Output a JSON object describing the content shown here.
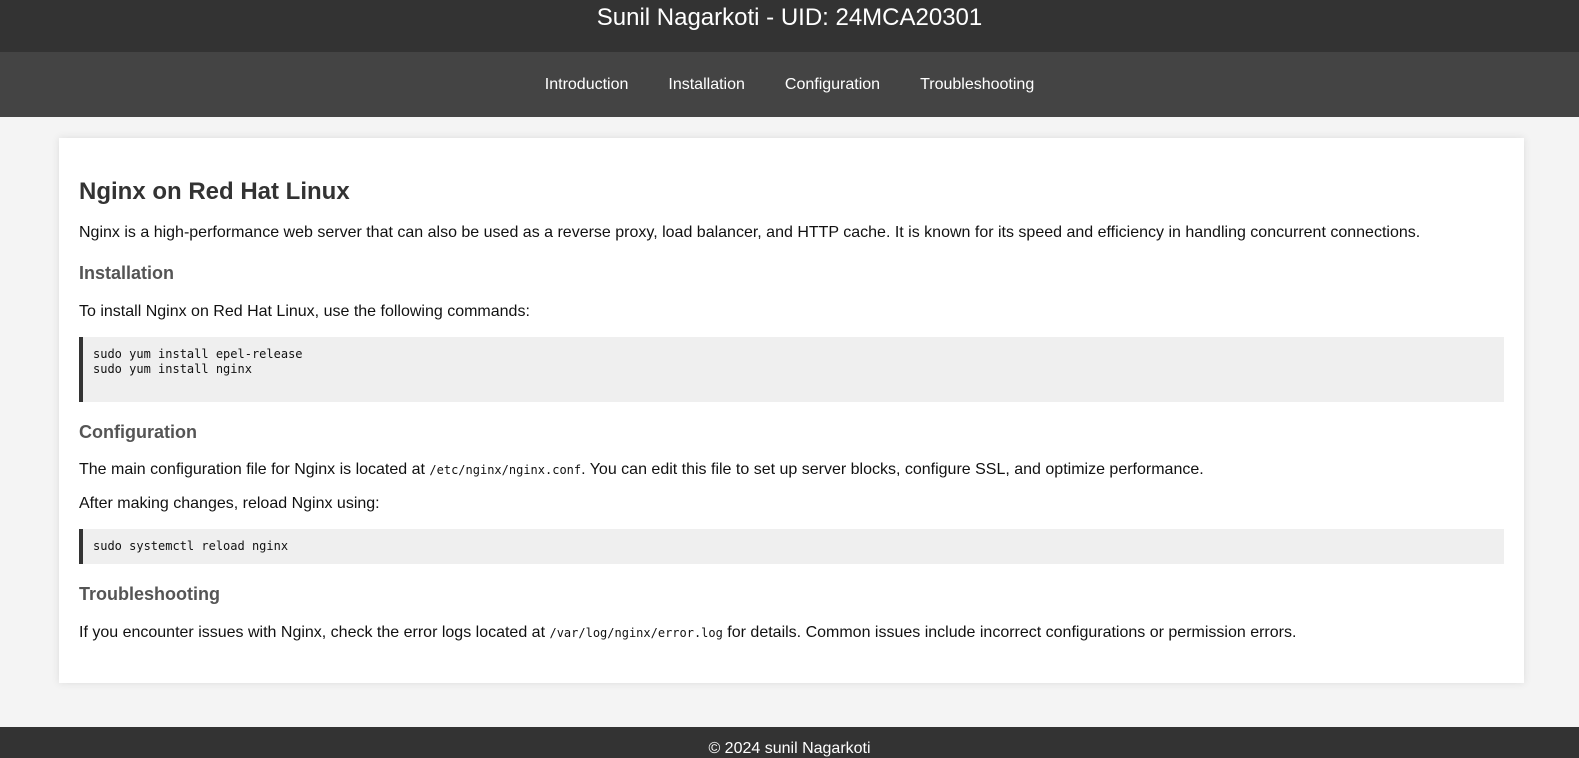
{
  "header": {
    "title": "Sunil Nagarkoti - UID: 24MCA20301"
  },
  "nav": {
    "items": [
      {
        "label": "Introduction"
      },
      {
        "label": "Installation"
      },
      {
        "label": "Configuration"
      },
      {
        "label": "Troubleshooting"
      }
    ]
  },
  "main": {
    "title": "Nginx on Red Hat Linux",
    "intro": "Nginx is a high-performance web server that can also be used as a reverse proxy, load balancer, and HTTP cache. It is known for its speed and efficiency in handling concurrent connections.",
    "installation": {
      "heading": "Installation",
      "text": "To install Nginx on Red Hat Linux, use the following commands:",
      "code": "sudo yum install epel-release\nsudo yum install nginx"
    },
    "configuration": {
      "heading": "Configuration",
      "text_before": "The main configuration file for Nginx is located at ",
      "path": "/etc/nginx/nginx.conf",
      "text_after": ". You can edit this file to set up server blocks, configure SSL, and optimize performance.",
      "reload_text": "After making changes, reload Nginx using:",
      "code": "sudo systemctl reload nginx"
    },
    "troubleshooting": {
      "heading": "Troubleshooting",
      "text_before": "If you encounter issues with Nginx, check the error logs located at ",
      "path": "/var/log/nginx/error.log",
      "text_after": " for details. Common issues include incorrect configurations or permission errors."
    }
  },
  "footer": {
    "text": "© 2024 sunil Nagarkoti"
  }
}
